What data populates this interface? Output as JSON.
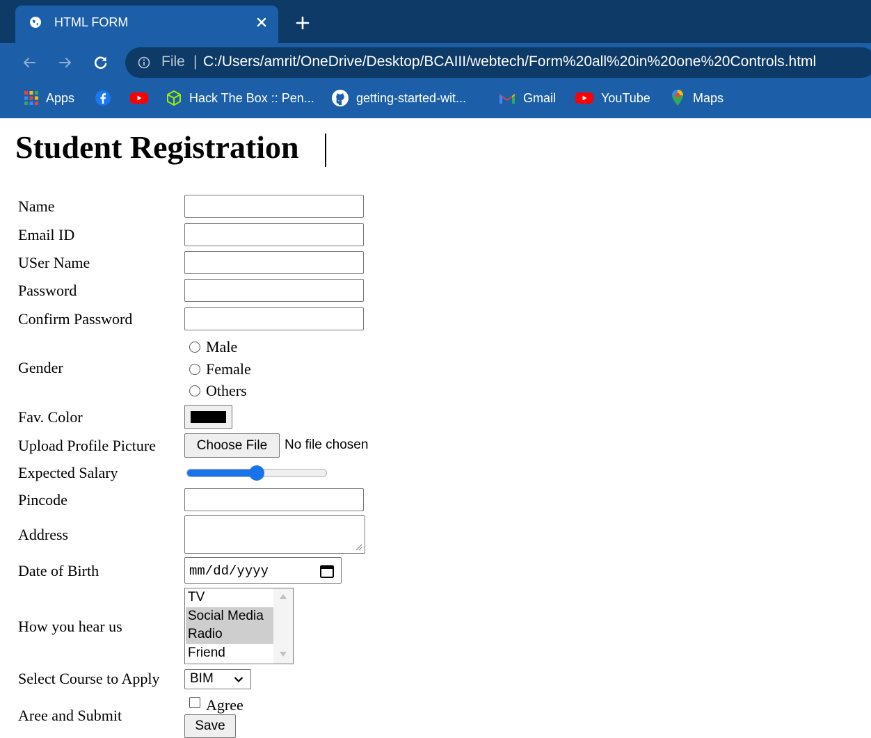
{
  "browser": {
    "tab_title": "HTML FORM",
    "omnibox": {
      "scheme_label": "File",
      "separator": "|",
      "url": "C:/Users/amrit/OneDrive/Desktop/BCAIII/webtech/Form%20all%20in%20one%20Controls.html"
    },
    "bookmarks": [
      {
        "label": "Apps",
        "icon": "apps-grid-icon"
      },
      {
        "label": "",
        "icon": "facebook-icon"
      },
      {
        "label": "",
        "icon": "youtube-icon"
      },
      {
        "label": "Hack The Box :: Pen...",
        "icon": "hackthebox-icon"
      },
      {
        "label": "getting-started-wit...",
        "icon": "github-icon"
      },
      {
        "label": "Gmail",
        "icon": "gmail-icon"
      },
      {
        "label": "YouTube",
        "icon": "youtube-icon"
      },
      {
        "label": "Maps",
        "icon": "maps-icon"
      }
    ]
  },
  "page": {
    "title": "Student Registration"
  },
  "form": {
    "name_label": "Name",
    "name_value": "",
    "email_label": "Email ID",
    "email_value": "",
    "username_label": "USer Name",
    "username_value": "",
    "password_label": "Password",
    "password_value": "",
    "confirm_password_label": "Confirm Password",
    "confirm_password_value": "",
    "gender_label": "Gender",
    "gender_options": [
      {
        "label": "Male",
        "checked": false
      },
      {
        "label": "Female",
        "checked": false
      },
      {
        "label": "Others",
        "checked": false
      }
    ],
    "fav_color_label": "Fav. Color",
    "fav_color_value": "#000000",
    "upload_label": "Upload Profile Picture",
    "choose_file_label": "Choose File",
    "no_file_text": "No file chosen",
    "salary_label": "Expected Salary",
    "salary_slider_fraction": 0.5,
    "pincode_label": "Pincode",
    "pincode_value": "",
    "address_label": "Address",
    "address_value": "",
    "dob_label": "Date of Birth",
    "dob_placeholder": "mm/dd/yyyy",
    "hear_label": "How you hear us",
    "hear_options": [
      {
        "label": "TV",
        "selected": false
      },
      {
        "label": "Social Media",
        "selected": true
      },
      {
        "label": "Radio",
        "selected": true
      },
      {
        "label": "Friend",
        "selected": false
      }
    ],
    "course_label": "Select Course to Apply",
    "course_selected": "BIM",
    "submit_label": "Aree and Submit",
    "agree_label": "Agree",
    "agree_checked": false,
    "save_label": "Save"
  },
  "colors": {
    "tabstrip_bg": "#0d3a66",
    "toolbar_bg": "#1c5fa8",
    "accent": "#1a73e8"
  }
}
